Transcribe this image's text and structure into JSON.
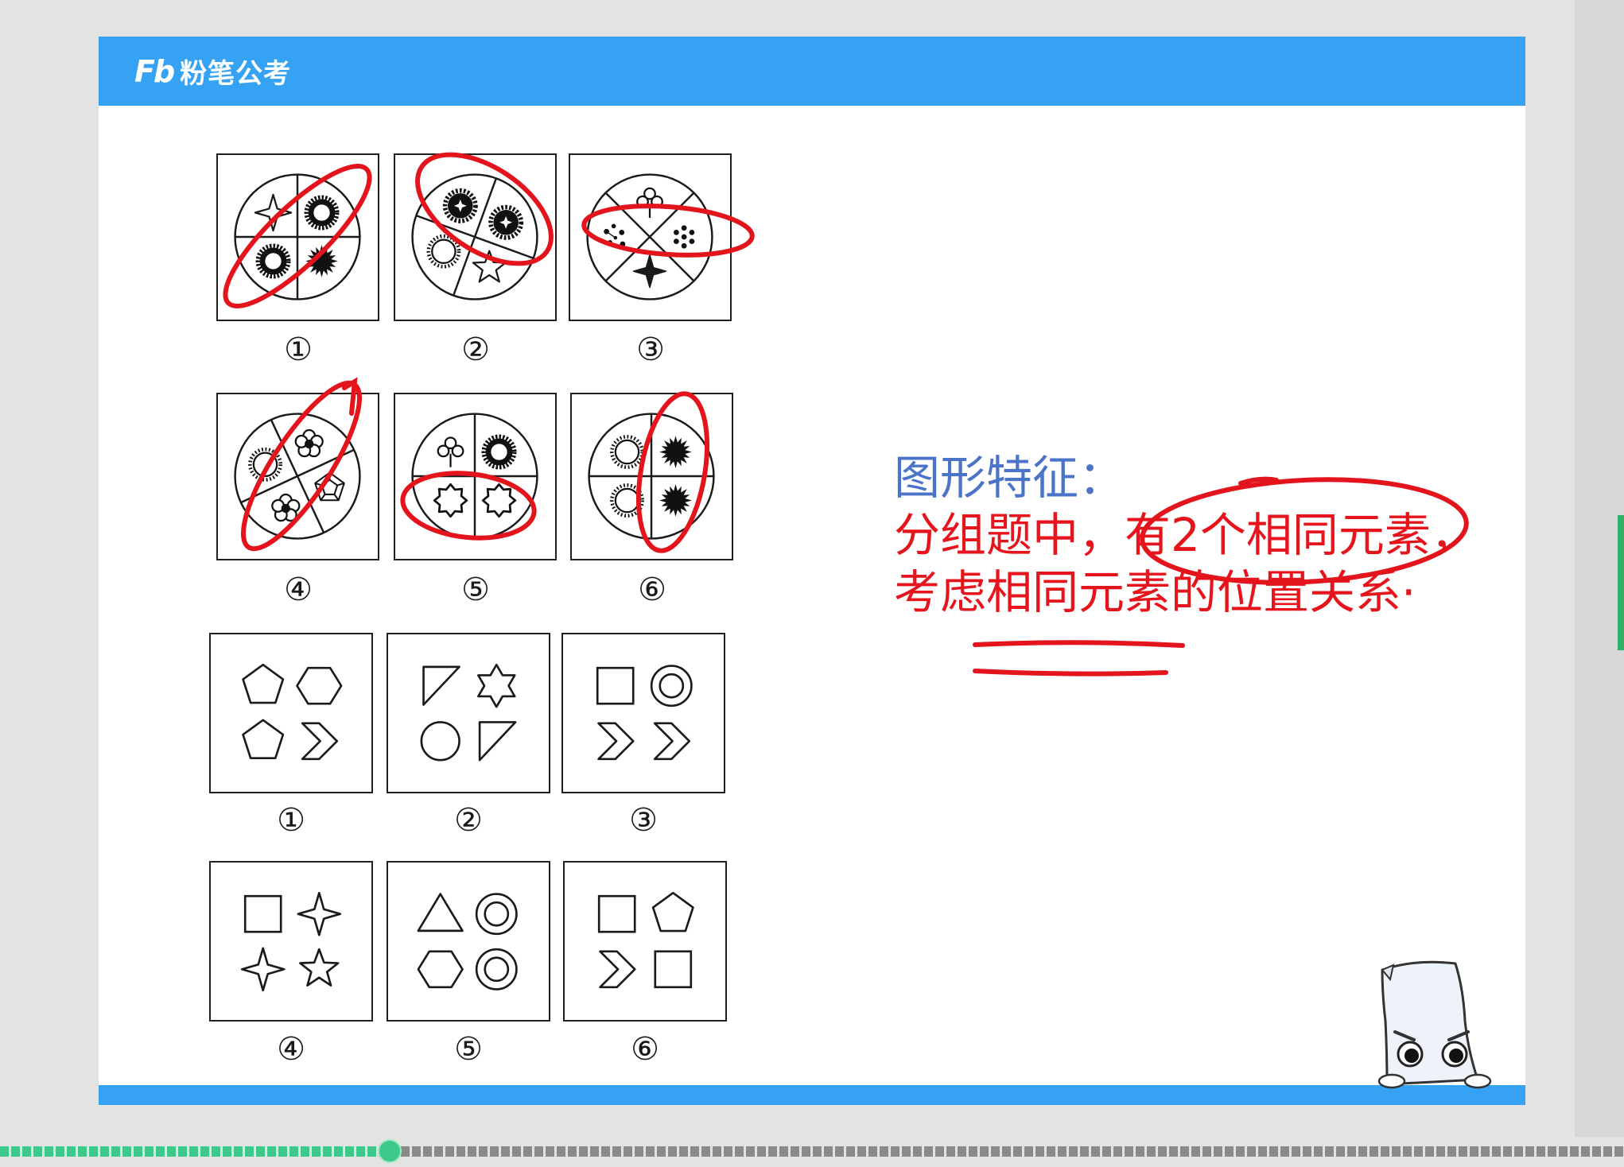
{
  "header": {
    "logo_mark": "Fb",
    "logo_text": "粉笔公考"
  },
  "colors": {
    "header_bar": "#35a2f3",
    "annotation": "#e3141b",
    "heading_text": "#4b74c9",
    "note_text": "#e6141c",
    "progress_played": "#3cc98a",
    "progress_remaining": "#8a8a8a"
  },
  "set_a": {
    "labels": [
      "①",
      "②",
      "③",
      "④",
      "⑤",
      "⑥"
    ],
    "panels": [
      {
        "divider": "plus",
        "quadrants": [
          "four-point-star",
          "black-sun",
          "black-burst",
          "black-sun"
        ]
      },
      {
        "divider": "slanted-right",
        "quadrants": [
          "black-gear",
          "black-gear",
          "five-point-star",
          "outline-sun"
        ]
      },
      {
        "divider": "x",
        "quadrants": [
          "clover",
          "flower-dots",
          "four-point-star-filled",
          "dots"
        ]
      },
      {
        "divider": "slanted-left",
        "quadrants": [
          "flower",
          "gem",
          "flower",
          "outline-sun"
        ]
      },
      {
        "divider": "plus",
        "quadrants": [
          "clover",
          "black-sun",
          "jagged",
          "jagged"
        ]
      },
      {
        "divider": "plus",
        "quadrants": [
          "outline-sun",
          "black-burst",
          "black-burst",
          "outline-sun"
        ]
      }
    ]
  },
  "set_b": {
    "labels": [
      "①",
      "②",
      "③",
      "④",
      "⑤",
      "⑥"
    ],
    "panels": [
      {
        "shapes": [
          "pentagon",
          "hexagon",
          "pentagon",
          "chevron"
        ]
      },
      {
        "shapes": [
          "right-triangle",
          "six-point-star",
          "circle",
          "right-triangle"
        ]
      },
      {
        "shapes": [
          "square",
          "double-circle",
          "chevron",
          "chevron"
        ]
      },
      {
        "shapes": [
          "square",
          "four-point-star",
          "four-point-star",
          "five-point-star"
        ]
      },
      {
        "shapes": [
          "triangle",
          "double-circle",
          "hexagon",
          "double-circle"
        ]
      },
      {
        "shapes": [
          "square",
          "pentagon",
          "chevron",
          "square"
        ]
      }
    ]
  },
  "notes": {
    "heading": "图形特征：",
    "line1": "分组题中，有2个相同元素，",
    "line2": "考虑相同元素的位置关系·"
  },
  "player": {
    "progress": 0.24
  }
}
